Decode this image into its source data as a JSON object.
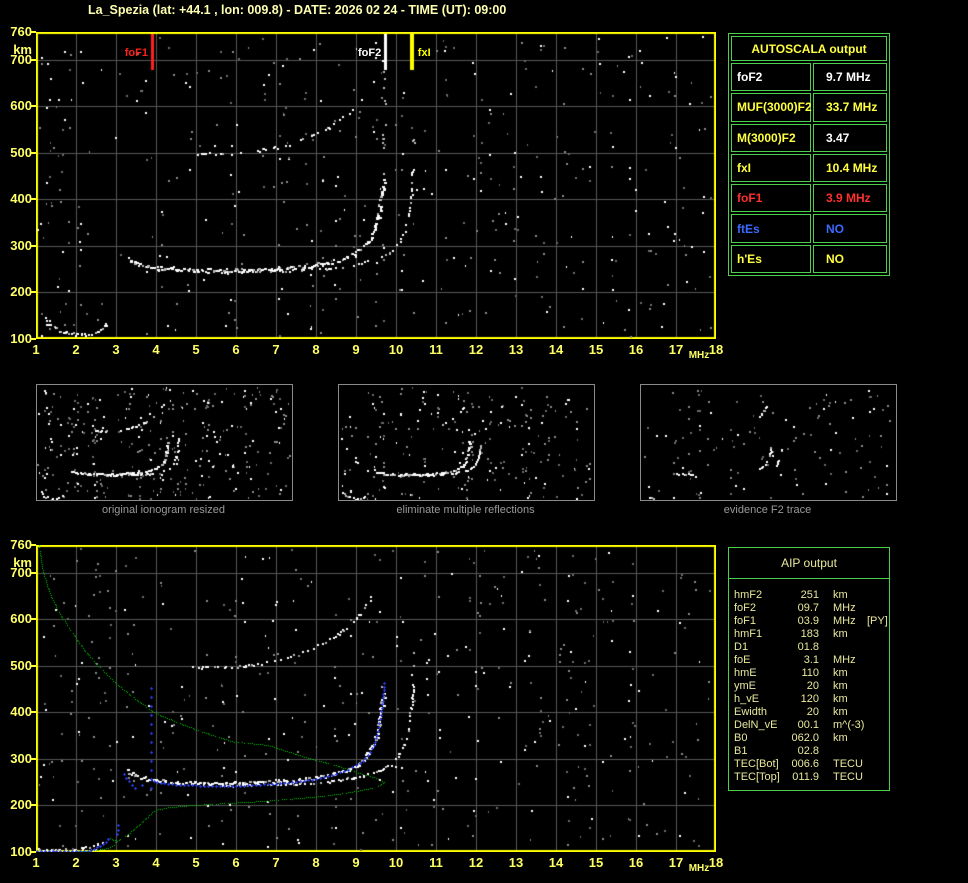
{
  "title": "La_Spezia (lat: +44.1 , lon: 009.8) - DATE: 2026 02 24 - TIME (UT): 09:00",
  "colors": {
    "title": "#ffffb0",
    "axis": "#ffff66",
    "frame": "#ffff00",
    "grid": "#565656",
    "table_border": "#4ad04a",
    "yellow": "#ffff40",
    "white": "#ffffff",
    "red": "#ff3030",
    "blue": "#3a6aff",
    "aip_text": "#e8e89c",
    "profile_green": "#00c800",
    "trace_blue": "#2a3cee",
    "caption_gray": "#9a9a9a"
  },
  "autoscala_table": {
    "title": "AUTOSCALA output",
    "rows": [
      {
        "label": "foF2",
        "value": "9.7 MHz",
        "label_color": "#ffffff",
        "value_color": "#ffffff"
      },
      {
        "label": "MUF(3000)F2",
        "value": "33.7 MHz",
        "label_color": "#ffff40",
        "value_color": "#ffff40"
      },
      {
        "label": "M(3000)F2",
        "value": "3.47",
        "label_color": "#ffff40",
        "value_color": "#ffffff"
      },
      {
        "label": "fxI",
        "value": "10.4 MHz",
        "label_color": "#ffff40",
        "value_color": "#ffff40"
      },
      {
        "label": "foF1",
        "value": "3.9 MHz",
        "label_color": "#ff3030",
        "value_color": "#ff3030"
      },
      {
        "label": "ftEs",
        "value": "NO",
        "label_color": "#3a6aff",
        "value_color": "#3a6aff"
      },
      {
        "label": "h'Es",
        "value": "NO",
        "label_color": "#ffff40",
        "value_color": "#ffff40"
      }
    ]
  },
  "aip_table": {
    "title": "AIP output",
    "rows": [
      {
        "label": "hmF2",
        "value": "251",
        "unit": "km",
        "note": ""
      },
      {
        "label": "foF2",
        "value": "09.7",
        "unit": "MHz",
        "note": ""
      },
      {
        "label": "foF1",
        "value": "03.9",
        "unit": "MHz",
        "note": "[PY]"
      },
      {
        "label": "hmF1",
        "value": "183",
        "unit": "km",
        "note": ""
      },
      {
        "label": "D1",
        "value": "01.8",
        "unit": "",
        "note": ""
      },
      {
        "label": "foE",
        "value": "3.1",
        "unit": "MHz",
        "note": ""
      },
      {
        "label": "hmE",
        "value": "110",
        "unit": "km",
        "note": ""
      },
      {
        "label": "ymE",
        "value": "20",
        "unit": "km",
        "note": ""
      },
      {
        "label": "h_vE",
        "value": "120",
        "unit": "km",
        "note": ""
      },
      {
        "label": "Ewidth",
        "value": "20",
        "unit": "km",
        "note": ""
      },
      {
        "label": "DelN_vE",
        "value": "00.1",
        "unit": "m^(-3)",
        "note": ""
      },
      {
        "label": "B0",
        "value": "062.0",
        "unit": "km",
        "note": ""
      },
      {
        "label": "B1",
        "value": "02.8",
        "unit": "",
        "note": ""
      },
      {
        "label": "TEC[Bot]",
        "value": "006.6",
        "unit": "TECU",
        "note": ""
      },
      {
        "label": "TEC[Top]",
        "value": "011.9",
        "unit": "TECU",
        "note": ""
      }
    ]
  },
  "thumbnails": [
    {
      "caption": "original ionogram resized"
    },
    {
      "caption": "eliminate multiple reflections"
    },
    {
      "caption": "evidence F2 trace"
    }
  ],
  "chart_data": {
    "type": "scatter",
    "xlabel": "MHz",
    "ylabel": "km",
    "xlim": [
      1,
      18
    ],
    "ylim": [
      100,
      760
    ],
    "x_ticks": [
      1,
      2,
      3,
      4,
      5,
      6,
      7,
      8,
      9,
      10,
      11,
      12,
      13,
      14,
      15,
      16,
      17,
      18
    ],
    "y_ticks": [
      760,
      700,
      600,
      500,
      400,
      300,
      200,
      100
    ],
    "x_unit": "MHz",
    "y_unit": "km",
    "markers": [
      {
        "label": "foF1",
        "freq": 3.9,
        "color": "#ff2020",
        "side": "left"
      },
      {
        "label": "foF2",
        "freq": 9.73,
        "color": "#ffffff",
        "side": "left"
      },
      {
        "label": "fxI",
        "freq": 10.37,
        "color": "#ffff00",
        "side": "right"
      }
    ],
    "series_lib": {
      "E1": {
        "style": "scatter",
        "color": "#ffffff",
        "density": 0.85,
        "size": 2,
        "jitter": 1.4,
        "points": [
          [
            1.2,
            150
          ],
          [
            1.35,
            132
          ],
          [
            1.55,
            120
          ],
          [
            1.8,
            113
          ],
          [
            2.05,
            111
          ],
          [
            2.35,
            112
          ],
          [
            2.55,
            117
          ],
          [
            2.7,
            128
          ],
          [
            2.8,
            142
          ]
        ]
      },
      "E2": {
        "style": "scatter",
        "color": "#ffffff",
        "density": 0.6,
        "size": 2,
        "jitter": 1.2,
        "points": [
          [
            1.05,
            108
          ],
          [
            1.4,
            106
          ],
          [
            1.8,
            106
          ],
          [
            2.1,
            108
          ],
          [
            2.35,
            112
          ],
          [
            2.55,
            118
          ],
          [
            2.7,
            126
          ]
        ]
      },
      "FO": {
        "style": "scatter",
        "color": "#ffffff",
        "density": 1.0,
        "size": 3,
        "jitter": 1.8,
        "points": [
          [
            3.3,
            274
          ],
          [
            3.5,
            263
          ],
          [
            3.8,
            257
          ],
          [
            4.3,
            252
          ],
          [
            5.0,
            249
          ],
          [
            5.7,
            248
          ],
          [
            6.4,
            250
          ],
          [
            7.0,
            253
          ],
          [
            7.5,
            256
          ],
          [
            8.0,
            261
          ],
          [
            8.4,
            268
          ],
          [
            8.8,
            279
          ],
          [
            9.05,
            291
          ],
          [
            9.25,
            307
          ],
          [
            9.4,
            328
          ],
          [
            9.5,
            352
          ],
          [
            9.58,
            382
          ],
          [
            9.64,
            414
          ],
          [
            9.68,
            444
          ]
        ]
      },
      "FX": {
        "style": "scatter",
        "color": "#ffffff",
        "density": 0.55,
        "size": 2,
        "jitter": 1.1,
        "points": [
          [
            5.6,
            244
          ],
          [
            6.3,
            245
          ],
          [
            7.0,
            247
          ],
          [
            7.6,
            249
          ],
          [
            8.2,
            252
          ],
          [
            8.7,
            257
          ],
          [
            9.1,
            264
          ],
          [
            9.5,
            274
          ],
          [
            9.85,
            289
          ],
          [
            10.05,
            308
          ],
          [
            10.2,
            334
          ],
          [
            10.3,
            368
          ],
          [
            10.36,
            404
          ],
          [
            10.4,
            442
          ],
          [
            10.42,
            470
          ]
        ]
      },
      "HOP2": {
        "style": "scatter",
        "color": "#ffffff",
        "density": 0.45,
        "size": 2,
        "jitter": 1.3,
        "points": [
          [
            4.9,
            497
          ],
          [
            5.4,
            500
          ],
          [
            5.9,
            498
          ],
          [
            6.4,
            503
          ],
          [
            6.9,
            511
          ],
          [
            7.4,
            523
          ],
          [
            7.9,
            539
          ],
          [
            8.3,
            556
          ],
          [
            8.65,
            577
          ],
          [
            8.95,
            600
          ],
          [
            9.15,
            620
          ],
          [
            9.3,
            638
          ],
          [
            9.42,
            655
          ]
        ]
      },
      "HOP2_STEEP": {
        "style": "scatter",
        "color": "#ffffff",
        "density": 0.5,
        "size": 2,
        "jitter": 1.2,
        "points": [
          [
            7.4,
            523
          ],
          [
            7.9,
            539
          ],
          [
            8.3,
            556
          ],
          [
            8.65,
            577
          ],
          [
            8.95,
            600
          ],
          [
            9.15,
            620
          ],
          [
            9.3,
            638
          ],
          [
            9.42,
            655
          ]
        ]
      },
      "ASYM_O": {
        "style": "scatter",
        "color": "#cccccc",
        "density": 0.12,
        "size": 2,
        "jitter": 1.5,
        "points": [
          [
            9.66,
            450
          ],
          [
            9.66,
            555
          ]
        ]
      },
      "ASYM_H2": {
        "style": "scatter",
        "color": "#bbbbbb",
        "density": 0.1,
        "size": 2,
        "jitter": 1.5,
        "points": [
          [
            9.7,
            560
          ],
          [
            9.72,
            700
          ]
        ]
      },
      "ASYM_X": {
        "style": "scatter",
        "color": "#bbbbbb",
        "density": 0.1,
        "size": 2,
        "jitter": 1.5,
        "points": [
          [
            10.42,
            475
          ],
          [
            10.42,
            545
          ]
        ]
      },
      "PROFILE": {
        "style": "dots",
        "color": "#00c800",
        "density": 0.92,
        "size": 1,
        "points": [
          [
            1.07,
            760
          ],
          [
            1.15,
            715
          ],
          [
            1.25,
            680
          ],
          [
            1.4,
            645
          ],
          [
            1.6,
            612
          ],
          [
            1.8,
            585
          ],
          [
            2.0,
            560
          ],
          [
            2.2,
            535
          ],
          [
            2.45,
            510
          ],
          [
            2.7,
            487
          ],
          [
            3.0,
            462
          ],
          [
            3.4,
            435
          ],
          [
            3.95,
            400
          ],
          [
            4.5,
            380
          ],
          [
            5.1,
            360
          ],
          [
            5.9,
            338
          ],
          [
            6.8,
            330
          ],
          [
            7.7,
            305
          ],
          [
            8.45,
            288
          ],
          [
            9.0,
            272
          ],
          [
            9.4,
            262
          ],
          [
            9.6,
            255
          ],
          [
            9.7,
            250
          ],
          [
            9.6,
            243
          ],
          [
            9.3,
            236
          ],
          [
            8.8,
            228
          ],
          [
            8.1,
            220
          ],
          [
            7.3,
            214
          ],
          [
            6.4,
            208
          ],
          [
            5.5,
            204
          ],
          [
            4.8,
            200
          ],
          [
            4.3,
            196
          ],
          [
            4.0,
            191
          ],
          [
            3.9,
            186
          ],
          [
            3.75,
            173
          ],
          [
            3.6,
            161
          ],
          [
            3.45,
            150
          ],
          [
            3.3,
            139
          ],
          [
            3.15,
            130
          ],
          [
            3.03,
            124
          ],
          [
            2.92,
            126
          ],
          [
            2.86,
            130
          ],
          [
            2.94,
            126
          ],
          [
            3.0,
            119
          ],
          [
            2.9,
            113
          ],
          [
            2.75,
            108
          ],
          [
            2.55,
            105
          ],
          [
            2.3,
            102
          ],
          [
            2.0,
            101
          ],
          [
            1.7,
            100
          ],
          [
            1.48,
            99
          ]
        ]
      },
      "BLUE1": {
        "style": "plus",
        "color": "#2a3cee",
        "step": 4,
        "points": [
          [
            1.02,
            103
          ],
          [
            2.3,
            103
          ],
          [
            2.45,
            107
          ],
          [
            2.6,
            113
          ],
          [
            2.75,
            122
          ],
          [
            2.85,
            132
          ]
        ]
      },
      "BLUE2": {
        "style": "plus",
        "color": "#2a3cee",
        "step": 5,
        "points": [
          [
            3.03,
            138
          ],
          [
            3.06,
            168
          ]
        ]
      },
      "BLUE3": {
        "style": "plus",
        "color": "#2a3cee",
        "step": 5,
        "points": [
          [
            3.2,
            268
          ],
          [
            3.32,
            252
          ],
          [
            3.48,
            238
          ],
          [
            3.65,
            243
          ],
          [
            3.8,
            252
          ]
        ]
      },
      "BLUE4": {
        "style": "plus",
        "color": "#2a3cee",
        "step": 9,
        "points": [
          [
            3.87,
            238
          ],
          [
            3.87,
            472
          ]
        ]
      },
      "BLUE5": {
        "style": "plus",
        "color": "#2a3cee",
        "step": 4,
        "points": [
          [
            3.95,
            252
          ],
          [
            4.2,
            248
          ],
          [
            4.5,
            245
          ],
          [
            5.0,
            243
          ],
          [
            5.5,
            242
          ],
          [
            6.0,
            242
          ],
          [
            6.5,
            244
          ],
          [
            7.0,
            247
          ],
          [
            7.5,
            251
          ],
          [
            8.0,
            257
          ],
          [
            8.4,
            265
          ],
          [
            8.8,
            277
          ],
          [
            9.1,
            291
          ],
          [
            9.3,
            308
          ],
          [
            9.45,
            330
          ],
          [
            9.55,
            360
          ],
          [
            9.62,
            395
          ],
          [
            9.67,
            425
          ],
          [
            9.7,
            455
          ],
          [
            9.72,
            472
          ]
        ]
      },
      "E_FRAG": {
        "style": "scatter",
        "color": "#ffffff",
        "density": 0.6,
        "size": 2,
        "jitter": 1.2,
        "points": [
          [
            1.5,
            116
          ],
          [
            2.1,
            117
          ]
        ]
      },
      "F1_FRAG": {
        "style": "scatter",
        "color": "#ffffff",
        "density": 0.7,
        "size": 2,
        "jitter": 1.4,
        "points": [
          [
            3.35,
            256
          ],
          [
            4.5,
            252
          ]
        ]
      },
      "O_ARC": {
        "style": "scatter",
        "color": "#ffffff",
        "density": 0.8,
        "size": 2,
        "jitter": 1.2,
        "points": [
          [
            8.8,
            278
          ],
          [
            9.2,
            302
          ],
          [
            9.45,
            335
          ],
          [
            9.58,
            375
          ],
          [
            9.65,
            415
          ]
        ]
      },
      "X_ARC": {
        "style": "scatter",
        "color": "#ffffff",
        "density": 0.6,
        "size": 2,
        "jitter": 1.2,
        "points": [
          [
            9.9,
            292
          ],
          [
            10.1,
            322
          ],
          [
            10.25,
            362
          ],
          [
            10.34,
            405
          ],
          [
            10.38,
            432
          ]
        ]
      },
      "HOP2_ARC": {
        "style": "scatter",
        "color": "#ffffff",
        "density": 0.6,
        "size": 2,
        "jitter": 1.2,
        "points": [
          [
            8.85,
            585
          ],
          [
            9.1,
            612
          ],
          [
            9.3,
            636
          ],
          [
            9.4,
            652
          ]
        ]
      }
    },
    "plots": [
      {
        "name": "scaled-ionogram",
        "grid": true,
        "markers": true,
        "seed": 101,
        "noise_uniform": 240,
        "noise_columns": 50,
        "series": [
          "E1",
          "FO",
          "FX",
          "HOP2",
          "ASYM_O",
          "ASYM_H2",
          "ASYM_X"
        ]
      },
      {
        "name": "aip-ionogram",
        "grid": true,
        "markers": false,
        "seed": 202,
        "noise_uniform": 260,
        "noise_columns": 55,
        "series": [
          "E2",
          "FO",
          "FX",
          "HOP2",
          "ASYM_O",
          "ASYM_X",
          "PROFILE",
          "BLUE1",
          "BLUE2",
          "BLUE3",
          "BLUE4",
          "BLUE5"
        ]
      }
    ],
    "thumb_plots": [
      {
        "name": "original-ionogram-resized",
        "seed": 303,
        "noise_uniform": 230,
        "noise_columns": 25,
        "series": [
          "E1",
          "FO",
          "FX",
          "HOP2"
        ]
      },
      {
        "name": "eliminate-multiple-reflections",
        "seed": 404,
        "noise_uniform": 160,
        "noise_columns": 18,
        "series": [
          "E1",
          "FO",
          "FX",
          "HOP2_STEEP"
        ]
      },
      {
        "name": "evidence-F2-trace",
        "seed": 505,
        "noise_uniform": 90,
        "noise_columns": 10,
        "series": [
          "E_FRAG",
          "F1_FRAG",
          "O_ARC",
          "X_ARC",
          "HOP2_ARC"
        ]
      }
    ]
  }
}
